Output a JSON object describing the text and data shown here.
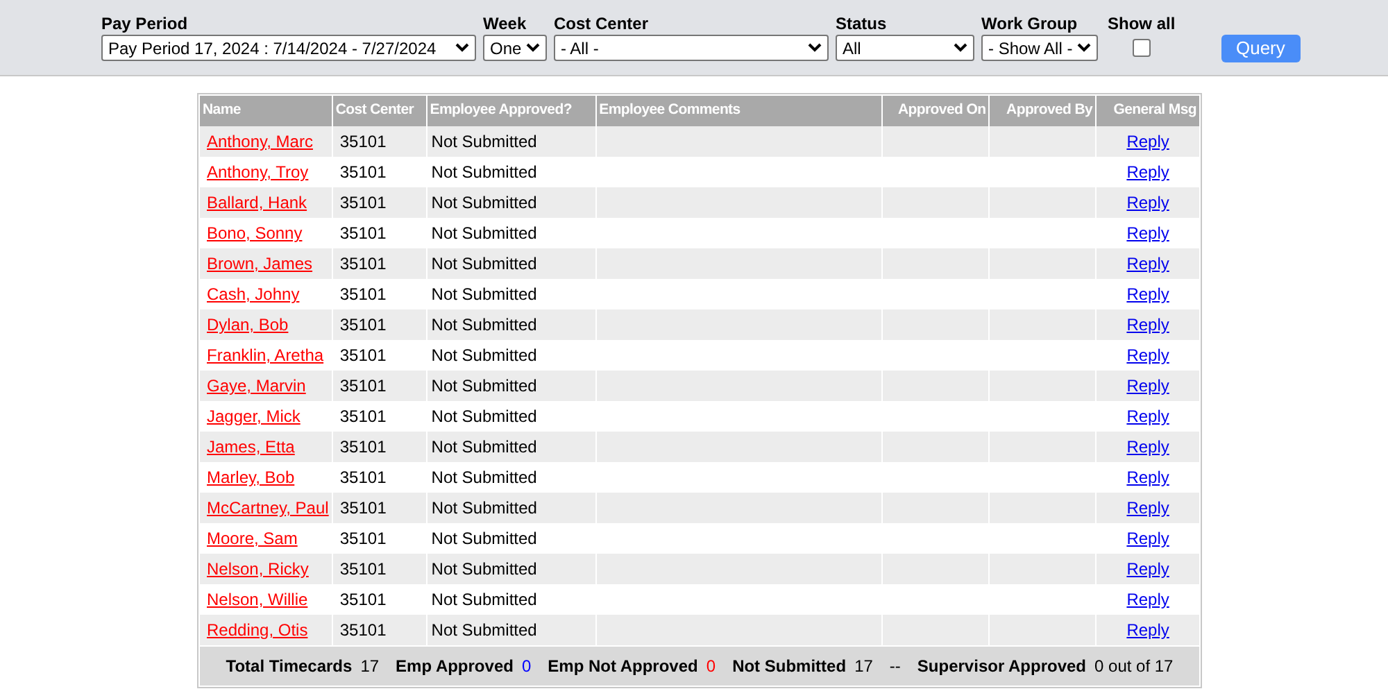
{
  "filters": [
    {
      "label": "Pay Period",
      "value": "Pay Period 17, 2024 : 7/14/2024 - 7/27/2024",
      "kind": "select"
    },
    {
      "label": "Week",
      "value": "One",
      "kind": "select"
    },
    {
      "label": "Cost Center",
      "value": "- All -",
      "kind": "select"
    },
    {
      "label": "Status",
      "value": "All",
      "kind": "select"
    },
    {
      "label": "Work Group",
      "value": "- Show All -",
      "kind": "select"
    },
    {
      "label": "Show all",
      "checked": false,
      "kind": "checkbox"
    }
  ],
  "query_button": "Query",
  "table": {
    "columns": [
      "Name",
      "Cost Center",
      "Employee Approved?",
      "Employee Comments",
      "Approved On",
      "Approved By",
      "General Msg"
    ],
    "rows": [
      {
        "name": "Anthony, Marc",
        "cost_center": "35101",
        "status": "Not Submitted",
        "action": "Reply"
      },
      {
        "name": "Anthony, Troy",
        "cost_center": "35101",
        "status": "Not Submitted",
        "action": "Reply"
      },
      {
        "name": "Ballard, Hank",
        "cost_center": "35101",
        "status": "Not Submitted",
        "action": "Reply"
      },
      {
        "name": "Bono, Sonny",
        "cost_center": "35101",
        "status": "Not Submitted",
        "action": "Reply"
      },
      {
        "name": "Brown, James",
        "cost_center": "35101",
        "status": "Not Submitted",
        "action": "Reply"
      },
      {
        "name": "Cash, Johny",
        "cost_center": "35101",
        "status": "Not Submitted",
        "action": "Reply"
      },
      {
        "name": "Dylan, Bob",
        "cost_center": "35101",
        "status": "Not Submitted",
        "action": "Reply"
      },
      {
        "name": "Franklin, Aretha",
        "cost_center": "35101",
        "status": "Not Submitted",
        "action": "Reply"
      },
      {
        "name": "Gaye, Marvin",
        "cost_center": "35101",
        "status": "Not Submitted",
        "action": "Reply"
      },
      {
        "name": "Jagger, Mick",
        "cost_center": "35101",
        "status": "Not Submitted",
        "action": "Reply"
      },
      {
        "name": "James, Etta",
        "cost_center": "35101",
        "status": "Not Submitted",
        "action": "Reply"
      },
      {
        "name": "Marley, Bob",
        "cost_center": "35101",
        "status": "Not Submitted",
        "action": "Reply"
      },
      {
        "name": "McCartney, Paul",
        "cost_center": "35101",
        "status": "Not Submitted",
        "action": "Reply"
      },
      {
        "name": "Moore, Sam",
        "cost_center": "35101",
        "status": "Not Submitted",
        "action": "Reply"
      },
      {
        "name": "Nelson, Ricky",
        "cost_center": "35101",
        "status": "Not Submitted",
        "action": "Reply"
      },
      {
        "name": "Nelson, Willie",
        "cost_center": "35101",
        "status": "Not Submitted",
        "action": "Reply"
      },
      {
        "name": "Redding, Otis",
        "cost_center": "35101",
        "status": "Not Submitted",
        "action": "Reply"
      }
    ]
  },
  "summary": [
    {
      "label": "Total Timecards",
      "value": "17",
      "color": "#000000"
    },
    {
      "label": "Emp Approved",
      "value": "0",
      "color": "#0000ff"
    },
    {
      "label": "Emp Not Approved",
      "value": "0",
      "color": "#ff0000"
    },
    {
      "label": "Not Submitted",
      "value": "17",
      "color": "#000000"
    },
    {
      "label": "--"
    },
    {
      "label": "Supervisor Approved",
      "value": "0 out of 17",
      "color": "#000000"
    }
  ]
}
